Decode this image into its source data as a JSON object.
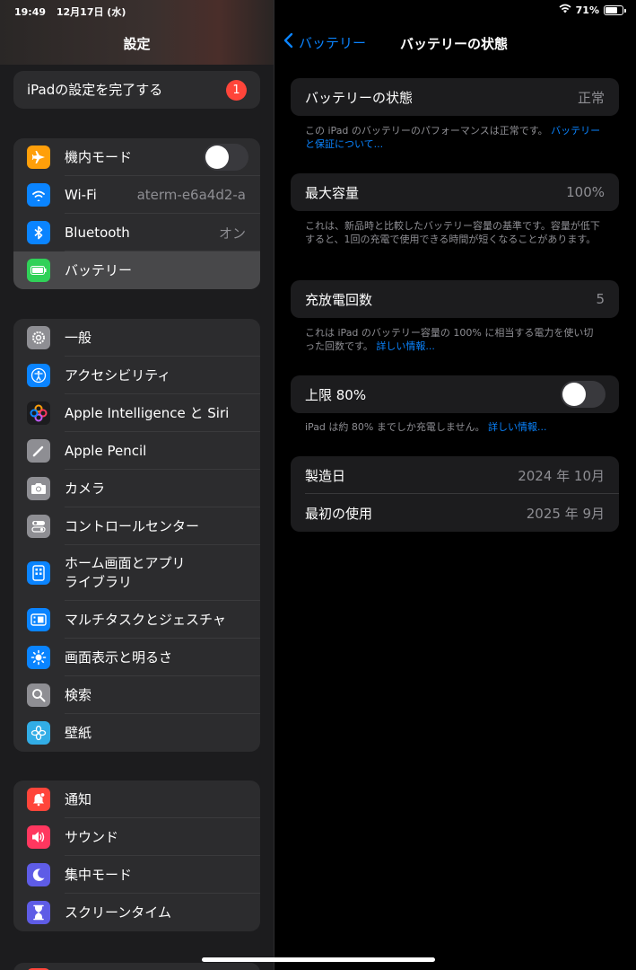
{
  "status": {
    "time": "19:49",
    "date": "12月17日 (水)",
    "battery_percent": "71%",
    "battery_level": 0.71
  },
  "sidebar": {
    "title": "設定",
    "setup": {
      "label": "iPadの設定を完了する",
      "badge": "1"
    },
    "groups": [
      [
        {
          "label": "機内モード",
          "icon": "airplane-icon",
          "color": "#ff9f0a",
          "toggle": false
        },
        {
          "label": "Wi-Fi",
          "icon": "wifi-icon",
          "color": "#0a84ff",
          "value": "aterm-e6a4d2-a"
        },
        {
          "label": "Bluetooth",
          "icon": "bluetooth-icon",
          "color": "#0a84ff",
          "value": "オン"
        },
        {
          "label": "バッテリー",
          "icon": "battery-icon",
          "color": "#30d158",
          "selected": true
        }
      ],
      [
        {
          "label": "一般",
          "icon": "gear-icon",
          "color": "#8e8e93"
        },
        {
          "label": "アクセシビリティ",
          "icon": "accessibility-icon",
          "color": "#0a84ff"
        },
        {
          "label": "Apple Intelligence と Siri",
          "icon": "siri-icon",
          "color": "#1c1c1e"
        },
        {
          "label": "Apple Pencil",
          "icon": "pencil-icon",
          "color": "#8e8e93"
        },
        {
          "label": "カメラ",
          "icon": "camera-icon",
          "color": "#8e8e93"
        },
        {
          "label": "コントロールセンター",
          "icon": "control-center-icon",
          "color": "#8e8e93"
        },
        {
          "label": "ホーム画面とアプリ\nライブラリ",
          "icon": "home-screen-icon",
          "color": "#0a84ff"
        },
        {
          "label": "マルチタスクとジェスチャ",
          "icon": "multitask-icon",
          "color": "#0a84ff"
        },
        {
          "label": "画面表示と明るさ",
          "icon": "brightness-icon",
          "color": "#0a84ff"
        },
        {
          "label": "検索",
          "icon": "search-icon",
          "color": "#8e8e93"
        },
        {
          "label": "壁紙",
          "icon": "wallpaper-icon",
          "color": "#32ade6"
        }
      ],
      [
        {
          "label": "通知",
          "icon": "notification-icon",
          "color": "#ff453a"
        },
        {
          "label": "サウンド",
          "icon": "sound-icon",
          "color": "#ff375f"
        },
        {
          "label": "集中モード",
          "icon": "moon-icon",
          "color": "#5e5ce6"
        },
        {
          "label": "スクリーンタイム",
          "icon": "hourglass-icon",
          "color": "#5e5ce6"
        }
      ]
    ]
  },
  "detail": {
    "back_label": "バッテリー",
    "title": "バッテリーの状態",
    "health": {
      "label": "バッテリーの状態",
      "value": "正常",
      "note": "この iPad のバッテリーのパフォーマンスは正常です。",
      "note_link": "バッテリーと保証について..."
    },
    "capacity": {
      "label": "最大容量",
      "value": "100%",
      "value_fraction": 1.0,
      "note": "これは、新品時と比較したバッテリー容量の基準です。容量が低下すると、1回の充電で使用できる時間が短くなることがあります。"
    },
    "cycles": {
      "label": "充放電回数",
      "value": "5",
      "note": "これは iPad のバッテリー容量の 100% に相当する電力を使い切った回数です。",
      "note_link": "詳しい情報..."
    },
    "limit": {
      "label": "上限 80%",
      "on": false,
      "note": "iPad は約 80% までしか充電しません。",
      "note_link": "詳しい情報..."
    },
    "dates": [
      {
        "label": "製造日",
        "value": "2024 年 10月"
      },
      {
        "label": "最初の使用",
        "value": "2025 年 9月"
      }
    ]
  }
}
